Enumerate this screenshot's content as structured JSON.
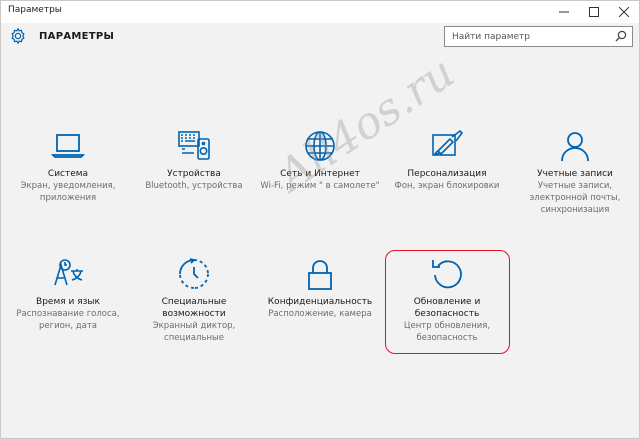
{
  "window": {
    "title": "Параметры"
  },
  "header": {
    "title": "ПАРАМЕТРЫ"
  },
  "search": {
    "placeholder": "Найти параметр"
  },
  "tiles": [
    {
      "name": "Система",
      "desc": "Экран, уведомления, приложения"
    },
    {
      "name": "Устройства",
      "desc": "Bluetooth, устройства"
    },
    {
      "name": "Сеть и Интернет",
      "desc": "Wi-Fi, режим \" в самолете\""
    },
    {
      "name": "Персонализация",
      "desc": "Фон, экран блокировки"
    },
    {
      "name": "Учетные записи",
      "desc": "Учетные записи, электронной почты, синхронизация"
    },
    {
      "name": "Время и язык",
      "desc": "Распознавание голоса, регион, дата"
    },
    {
      "name": "Специальные возможности",
      "desc": "Экранный диктор, специальные"
    },
    {
      "name": "Конфиденциальность",
      "desc": "Расположение, камера"
    },
    {
      "name": "Обновление и безопасность",
      "desc": "Центр обновления, безопасность"
    }
  ],
  "watermark": "All4os.ru",
  "colors": {
    "accent": "#0063b1",
    "highlight": "#e81123"
  }
}
